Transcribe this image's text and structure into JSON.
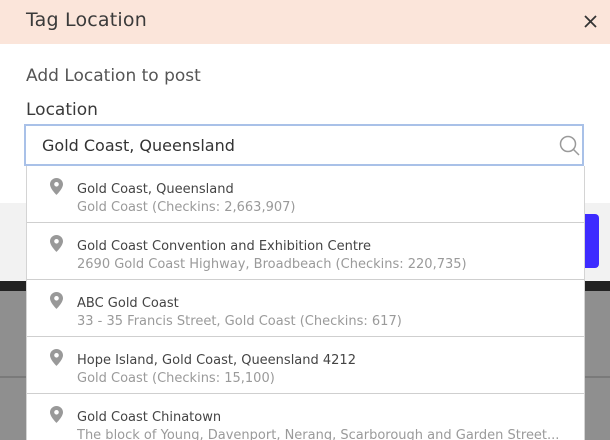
{
  "dialog": {
    "title": "Tag Location",
    "subtitle": "Add Location to post",
    "location_label": "Location"
  },
  "search": {
    "value": "Gold Coast, Queensland"
  },
  "results": [
    {
      "name": "Gold Coast, Queensland",
      "detail": "Gold Coast (Checkins: 2,663,907)"
    },
    {
      "name": "Gold Coast Convention and Exhibition Centre",
      "detail": "2690 Gold Coast Highway, Broadbeach (Checkins: 220,735)"
    },
    {
      "name": "ABC Gold Coast",
      "detail": "33 - 35 Francis Street, Gold Coast (Checkins: 617)"
    },
    {
      "name": "Hope Island, Gold Coast, Queensland 4212",
      "detail": "Gold Coast (Checkins: 15,100)"
    },
    {
      "name": "Gold Coast Chinatown",
      "detail": "The block of Young, Davenport, Nerang, Scarborough and Garden Street..."
    }
  ],
  "colors": {
    "header_bg": "#fbe5da",
    "input_border": "#a9c1e8",
    "primary_button": "#3d2bff"
  },
  "icons": {
    "close": "close-icon",
    "search": "search-icon",
    "pin": "map-pin-icon"
  }
}
